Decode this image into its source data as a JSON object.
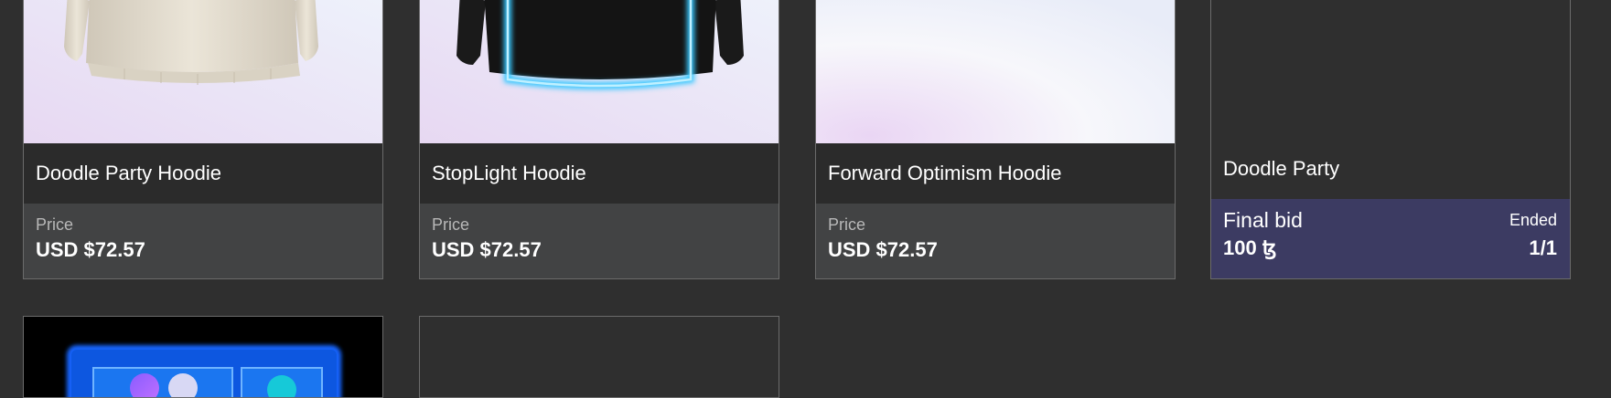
{
  "cards": [
    {
      "name": "Doodle Party Hoodie",
      "price_label": "Price",
      "price": "USD $72.57"
    },
    {
      "name": "StopLight Hoodie",
      "price_label": "Price",
      "price": "USD $72.57"
    },
    {
      "name": "Forward Optimism Hoodie",
      "price_label": "Price",
      "price": "USD $72.57"
    }
  ],
  "auction": {
    "name": "Doodle Party",
    "bid_label": "Final bid",
    "status": "Ended",
    "bid_value": "100 ꜩ",
    "edition": "1/1"
  },
  "colors": {
    "page_bg": "#2f2f2f",
    "card_name_bg": "#2b2b2b",
    "price_bg": "#424344",
    "auction_bg": "#3c3b62",
    "glow": "#39c8ff",
    "neon_blue": "#1565ff"
  }
}
